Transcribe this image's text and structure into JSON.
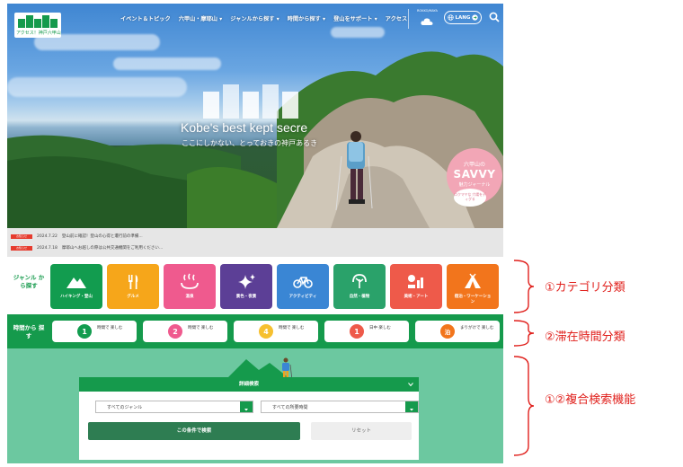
{
  "header": {
    "logo_text": "アクセス！神戸六甲山",
    "nav": [
      "イベント＆トピック",
      "六甲山・摩耶山 ▾",
      "ジャンルから探す ▾",
      "時間から探す ▾",
      "登山をサポート ▾",
      "アクセス"
    ],
    "weather_label": "ROKKO/MAYA",
    "lang_label": "LANG",
    "icons": {
      "weather": "cloud-icon",
      "lang": "globe-icon",
      "lang_arrow": "arrow-right-icon",
      "search": "search-icon"
    }
  },
  "hero": {
    "title": "Kobe's best kept secre",
    "subtitle": "ここにしかない、とっておきの神戸あるき",
    "savvy_script": "六甲山の",
    "savvy_title": "SAVVY",
    "savvy_sub": "魅力ジャーナル",
    "savvy_bubble": "ロクマヤな 穴場をディグる"
  },
  "news": [
    {
      "badge": "お知らせ",
      "date": "2024.7.22",
      "text": "登山前に確認！登山の心得と遭行前の準備..."
    },
    {
      "badge": "お知らせ",
      "date": "2024.7.18",
      "text": "摩耶山へお越しの際は公共交通機関をご利用ください..."
    }
  ],
  "genre": {
    "label": "ジャンル から探す",
    "items": [
      {
        "label": "ハイキング・登山",
        "color": "#129c4f",
        "icon": "mountain-icon"
      },
      {
        "label": "グルメ",
        "color": "#f6a61a",
        "icon": "fork-knife-icon"
      },
      {
        "label": "温泉",
        "color": "#ef5a8e",
        "icon": "hot-spring-icon"
      },
      {
        "label": "景色・夜景",
        "color": "#5c3f96",
        "icon": "sparkle-icon"
      },
      {
        "label": "アクティビティ",
        "color": "#3a86d4",
        "icon": "bicycle-icon"
      },
      {
        "label": "自然・植物",
        "color": "#2aa26a",
        "icon": "plant-icon"
      },
      {
        "label": "美術・アート",
        "color": "#ee5a4a",
        "icon": "art-icon"
      },
      {
        "label": "宿泊・ワーケーション",
        "color": "#f2751c",
        "icon": "tent-icon"
      }
    ]
  },
  "time": {
    "label": "時間から 探す",
    "items": [
      {
        "num": "1",
        "text": "時間で 楽しむ",
        "color": "#129c4f"
      },
      {
        "num": "2",
        "text": "時間で 楽しむ",
        "color": "#ef5a8e"
      },
      {
        "num": "4",
        "text": "時間で 楽しむ",
        "color": "#f6c030"
      },
      {
        "num": "1",
        "text": "日中 楽しむ",
        "color": "#ee5a4a"
      },
      {
        "num": "泊",
        "text": "まりがけで 楽しむ",
        "color": "#f2751c"
      }
    ]
  },
  "search": {
    "heading": "詳細検索",
    "genre_select": "すべてのジャンル",
    "time_select": "すべての所要時間",
    "submit_label": "この条件で検索",
    "reset_label": "リセット"
  },
  "annotations": [
    "①カテゴリ分類",
    "②滞在時間分類",
    "①②複合検索機能"
  ],
  "colors": {
    "brand_green": "#159a4c",
    "search_bg": "#6cc8a0",
    "annotation_red": "#e0201c"
  }
}
